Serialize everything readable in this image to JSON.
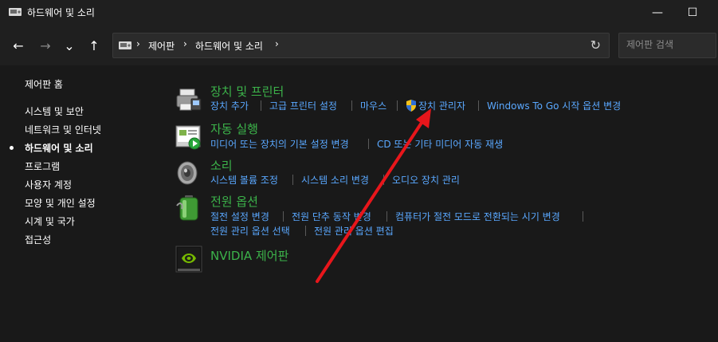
{
  "window": {
    "title": "하드웨어 및 소리",
    "minimize_glyph": "—",
    "maximize_glyph": "☐"
  },
  "nav": {
    "back_glyph": "←",
    "forward_glyph": "→",
    "recent_glyph": "⌄",
    "up_glyph": "↑",
    "refresh_glyph": "↻",
    "breadcrumb": [
      "제어판",
      "하드웨어 및 소리"
    ],
    "breadcrumb_sep": "›"
  },
  "search": {
    "placeholder": "제어판 검색"
  },
  "sidebar": {
    "home": "제어판 홈",
    "items": [
      {
        "label": "시스템 및 보안"
      },
      {
        "label": "네트워크 및 인터넷"
      },
      {
        "label": "하드웨어 및 소리",
        "active": true
      },
      {
        "label": "프로그램"
      },
      {
        "label": "사용자 계정"
      },
      {
        "label": "모양 및 개인 설정"
      },
      {
        "label": "시계 및 국가"
      },
      {
        "label": "접근성"
      }
    ]
  },
  "categories": [
    {
      "title": "장치 및 프린터",
      "icon": "printer-icon",
      "links": [
        "장치 추가",
        "고급 프린터 설정",
        "마우스",
        "장치 관리자",
        "Windows To Go 시작 옵션 변경"
      ]
    },
    {
      "title": "자동 실행",
      "icon": "autoplay-icon",
      "links": [
        "미디어 또는 장치의 기본 설정 변경",
        "CD 또는 기타 미디어 자동 재생"
      ]
    },
    {
      "title": "소리",
      "icon": "speaker-icon",
      "links": [
        "시스템 볼륨 조정",
        "시스템 소리 변경",
        "오디오 장치 관리"
      ]
    },
    {
      "title": "전원 옵션",
      "icon": "battery-icon",
      "links": [
        "절전 설정 변경",
        "전원 단추 동작 변경",
        "컴퓨터가 절전 모드로 전환되는 시기 변경",
        "전원 관리 옵션 선택",
        "전원 관리 옵션 편집"
      ]
    },
    {
      "title": "NVIDIA 제어판",
      "icon": "nvidia-icon",
      "links": []
    }
  ],
  "colors": {
    "background": "#191919",
    "category_title": "#3cb34a",
    "link": "#5aa8ff",
    "annotation_arrow": "#e8161b"
  }
}
